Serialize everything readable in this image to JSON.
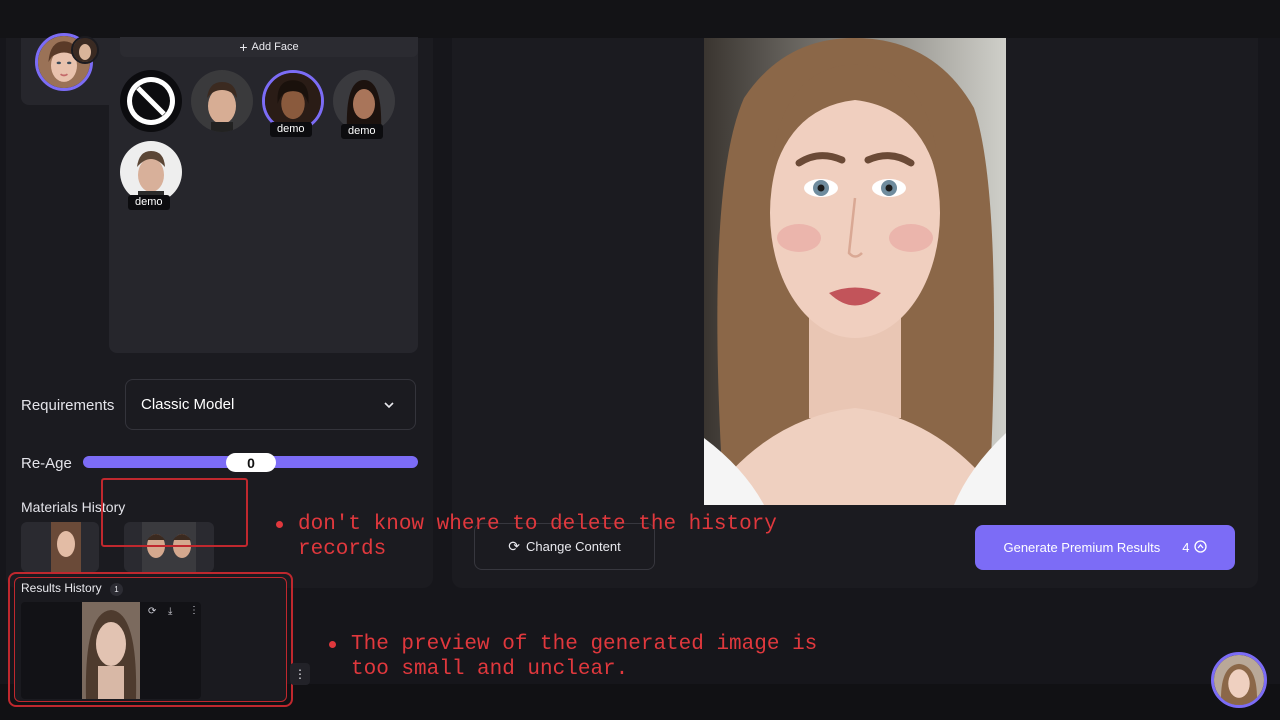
{
  "faces": {
    "add_face_label": "Add Face",
    "demo_tags": [
      "demo",
      "demo",
      "demo"
    ]
  },
  "requirements": {
    "label": "Requirements",
    "selected": "Classic Model"
  },
  "re_age": {
    "label": "Re-Age",
    "value": "0"
  },
  "materials_history": {
    "title": "Materials History"
  },
  "results_history": {
    "title": "Results History",
    "count": "1"
  },
  "buttons": {
    "change_content": "Change Content",
    "generate_premium": "Generate Premium Results",
    "credits": "4"
  },
  "annotations": {
    "note1_line1": "don't know where to delete the history",
    "note1_line2": "records",
    "note2_line1": "The preview of the generated image is",
    "note2_line2": "too small and unclear."
  },
  "colors": {
    "accent": "#7c6cf6",
    "annotation_red": "#e0383d",
    "panel_bg": "#1b1b20",
    "page_bg": "#16161b"
  }
}
